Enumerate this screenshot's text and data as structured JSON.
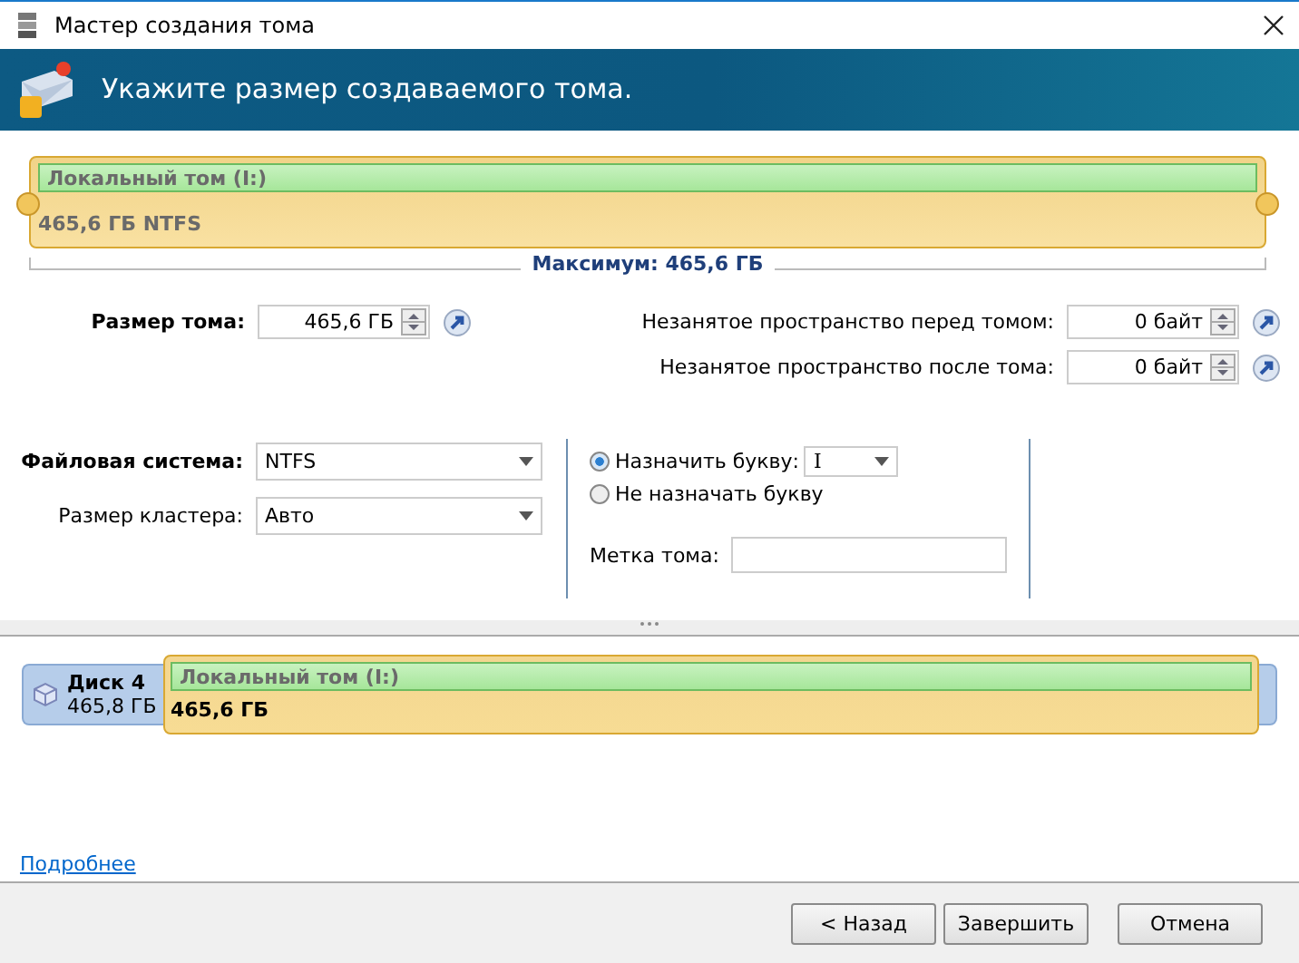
{
  "window": {
    "title": "Мастер создания тома"
  },
  "header": {
    "text": "Укажите размер создаваемого тома."
  },
  "volume_bar": {
    "label": "Локальный том (I:)",
    "info": "465,6 ГБ NTFS",
    "level": 1,
    "maximum": "Максимум: 465,6 ГБ"
  },
  "volume_size": {
    "label": "Размер тома:",
    "value": "465,6 ГБ"
  },
  "free_space": [
    {
      "label": "Незанятое пространство перед томом:",
      "value": "0 байт"
    },
    {
      "label": "Незанятое пространство после тома:",
      "value": "0 байт"
    }
  ],
  "file_system": {
    "label": "Файловая система:",
    "value": "NTFS"
  },
  "cluster_size": {
    "label": "Размер кластера:",
    "value": "Авто"
  },
  "letter_options": [
    {
      "label": "Назначить букву:",
      "selected": true,
      "letter": "I"
    },
    {
      "label": "Не назначать букву",
      "selected": false
    }
  ],
  "volume_label": {
    "label": "Метка тома:"
  },
  "disk_map": {
    "disk": "Диск 4",
    "capacity": "465,8 ГБ",
    "partition": {
      "label": "Локальный том (I:)",
      "size": "465,6 ГБ",
      "level": 1
    }
  },
  "link": "Подробнее",
  "buttons": [
    {
      "label": "< Назад",
      "kind": "normal"
    },
    {
      "label": "Завершить",
      "kind": "normal"
    },
    {
      "label": "Отмена",
      "kind": "cancel"
    }
  ]
}
